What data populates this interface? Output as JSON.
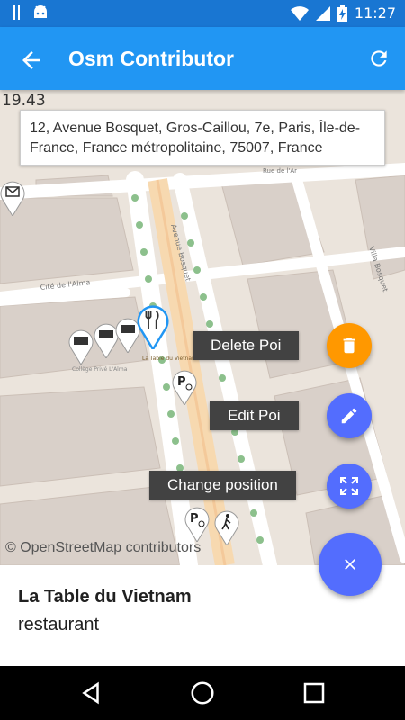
{
  "status_bar": {
    "time": "11:27",
    "icons": [
      "notification-bars-icon",
      "android-icon",
      "wifi-icon",
      "signal-icon",
      "battery-charging-icon"
    ]
  },
  "app_bar": {
    "title": "Osm Contributor",
    "back_icon": "arrow-back-icon",
    "refresh_icon": "refresh-icon",
    "color": "#2196f3"
  },
  "map": {
    "coordinate": "19.43",
    "address": "12, Avenue Bosquet, Gros-Caillou, 7e, Paris, Île-de-France, France métropolitaine, 75007, France",
    "attribution": "© OpenStreetMap contributors",
    "street_labels": {
      "avenue_bosquet": "Avenue Bosquet",
      "cite_alma": "Cité de l'Alma",
      "villa_bosquet": "Villa Bosquet",
      "rue_de": "Rue de l'Ar",
      "college": "Collège Privé L'Alma",
      "poi_label": "La Table du Vietnam"
    }
  },
  "actions": {
    "delete": "Delete Poi",
    "edit": "Edit Poi",
    "change_position": "Change position"
  },
  "colors": {
    "delete_fab": "#ff9800",
    "fab": "#536dfe",
    "label_bg": "#424242"
  },
  "poi": {
    "name": "La Table du Vietnam",
    "type": "restaurant"
  }
}
